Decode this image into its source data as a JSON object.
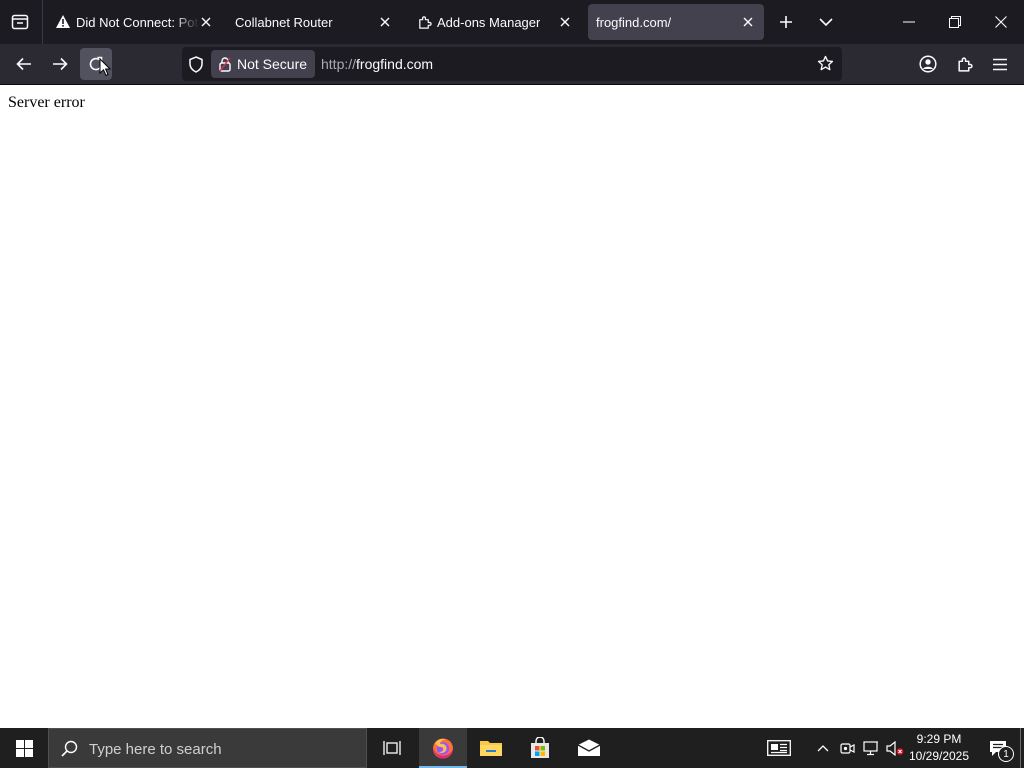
{
  "browser": {
    "tabs": [
      {
        "title": "Did Not Connect: Potential Security Issue",
        "icon": "warning-icon",
        "active": false
      },
      {
        "title": "Collabnet Router",
        "icon": "",
        "active": false
      },
      {
        "title": "Add-ons Manager",
        "icon": "puzzle-icon",
        "active": false
      },
      {
        "title": "frogfind.com/",
        "icon": "",
        "active": true
      }
    ],
    "toolbar": {
      "security_label": "Not Secure",
      "url_scheme": "http://",
      "url_host": "frogfind.com"
    }
  },
  "page": {
    "message": "Server error"
  },
  "taskbar": {
    "search_placeholder": "Type here to search",
    "time": "9:29 PM",
    "date": "10/29/2025",
    "notification_count": "1"
  },
  "colors": {
    "tab_active": "#42414d",
    "toolbar": "#2b2a33",
    "tabstrip": "#1c1b22",
    "taskbar": "#1f1f1f",
    "firefox_orange": "#ff7139"
  }
}
